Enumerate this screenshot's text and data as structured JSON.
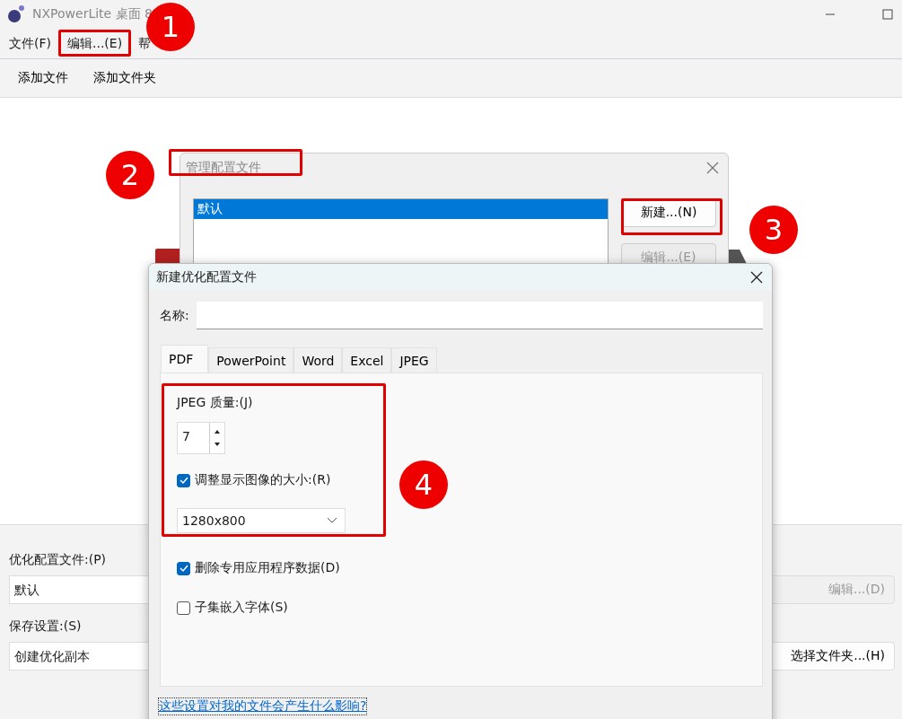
{
  "window": {
    "title": "NXPowerLite 桌面 8"
  },
  "menu": [
    {
      "label": "文件(F)"
    },
    {
      "label": "编辑...(E)"
    },
    {
      "label": "帮"
    }
  ],
  "toolbar": [
    "添加文件",
    "添加文件夹"
  ],
  "options": {
    "profile_label": "优化配置文件:(P)",
    "profile_value": "默认",
    "edit_button": "编辑...(D)",
    "save_label": "保存设置:(S)",
    "save_value": "创建优化副本",
    "folder_button": "选择文件夹...(H)"
  },
  "manage_dialog": {
    "title": "管理配置文件",
    "profiles": [
      {
        "label": "默认",
        "selected": true
      }
    ],
    "buttons": [
      {
        "label": "新建...(N)",
        "disabled": false
      },
      {
        "label": "编辑...(E)",
        "disabled": true
      }
    ]
  },
  "new_dialog": {
    "title": "新建优化配置文件",
    "name_label": "名称:",
    "tabs": [
      {
        "label": "PDF",
        "selected": true
      },
      {
        "label": "PowerPoint",
        "selected": false
      },
      {
        "label": "Word",
        "selected": false
      },
      {
        "label": "Excel",
        "selected": false
      },
      {
        "label": "JPEG",
        "selected": false
      }
    ],
    "quality_label": "JPEG 质量:(J)",
    "quality_value": "7",
    "settings": [
      {
        "kind": "checkbox",
        "label": "调整显示图像的大小:(R)",
        "checked": true
      },
      {
        "kind": "select",
        "value": "1280x800"
      },
      {
        "kind": "checkbox",
        "label": "删除专用应用程序数据(D)",
        "checked": true
      },
      {
        "kind": "checkbox",
        "label": "子集嵌入字体(S)",
        "checked": false
      }
    ],
    "help_link": "这些设置对我的文件会产生什么影响?"
  },
  "callouts": [
    {
      "label": "1"
    },
    {
      "label": "2"
    },
    {
      "label": "3"
    },
    {
      "label": "4"
    }
  ]
}
